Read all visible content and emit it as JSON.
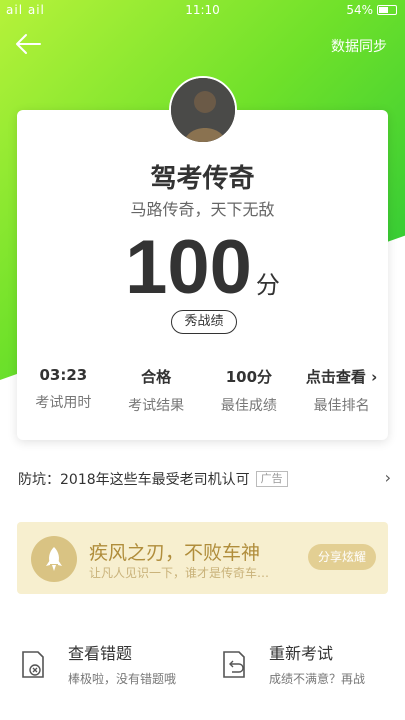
{
  "status": {
    "signal": "ail ail",
    "time": "11:10",
    "battery": "54%"
  },
  "header": {
    "sync_label": "数据同步"
  },
  "result": {
    "title": "驾考传奇",
    "subtitle": "马路传奇，天下无敌",
    "score": "100",
    "score_unit": "分",
    "show_button": "秀战绩"
  },
  "stats": [
    {
      "value": "03:23",
      "label": "考试用时"
    },
    {
      "value": "合格",
      "label": "考试结果"
    },
    {
      "value": "100分",
      "label": "最佳成绩"
    },
    {
      "value": "点击查看",
      "label": "最佳排名"
    }
  ],
  "ad": {
    "text": "防坑：2018年这些车最受老司机认可",
    "tag": "广告"
  },
  "banner": {
    "title": "疾风之刃，不败车神",
    "subtitle": "让凡人见识一下，谁才是传奇车…",
    "button": "分享炫耀"
  },
  "actions": [
    {
      "title": "查看错题",
      "subtitle": "棒极啦，没有错题哦"
    },
    {
      "title": "重新考试",
      "subtitle": "成绩不满意？再战"
    }
  ],
  "colors": {
    "hero_start": "#b6f23a",
    "hero_end": "#1ec33a",
    "banner_bg": "#f7efcf",
    "banner_text": "#b08d3b"
  }
}
